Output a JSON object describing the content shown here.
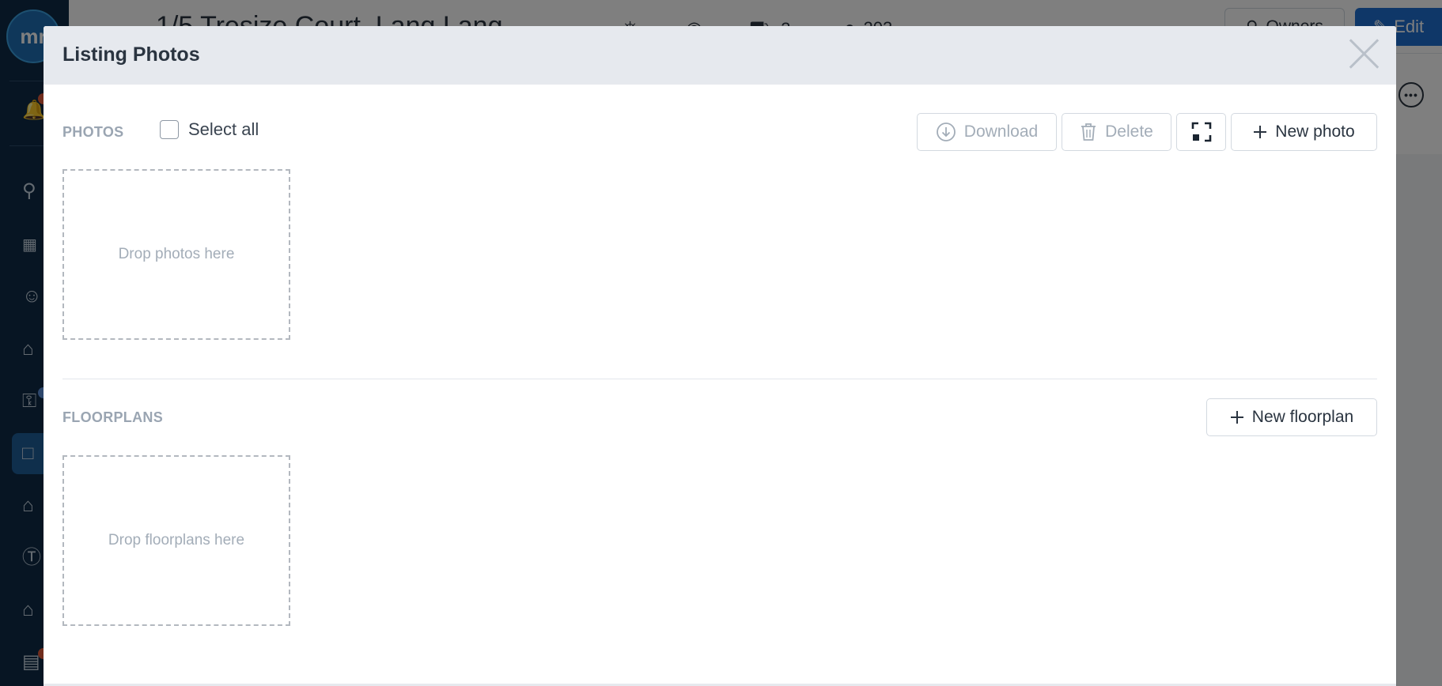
{
  "background": {
    "logo_text": "mr",
    "page_title": "1/5 Tresize Court, Lang Lang",
    "stats": [
      {
        "icon": "car-icon",
        "value": "3"
      },
      {
        "icon": "people-icon",
        "value": "203"
      }
    ],
    "owners_label": "Owners",
    "edit_label": "Edit",
    "sidebar_icons": [
      "bell-icon",
      "search-icon",
      "dashboard-icon",
      "person-icon",
      "home-icon",
      "key-icon",
      "listing-icon",
      "property-icon",
      "dollar-icon",
      "house-settings-icon",
      "document-icon"
    ]
  },
  "modal": {
    "title": "Listing Photos",
    "photos": {
      "section_label": "PHOTOS",
      "select_all_label": "Select all",
      "download_label": "Download",
      "delete_label": "Delete",
      "new_photo_label": "New photo",
      "dropzone_text": "Drop photos here"
    },
    "floorplans": {
      "section_label": "FLOORPLANS",
      "new_floorplan_label": "New floorplan",
      "dropzone_text": "Drop floorplans here"
    }
  },
  "colors": {
    "accent": "#1f6fd0",
    "sidebar": "#0f2b47",
    "header": "#e6e9ee",
    "muted_text": "#9aa5b2"
  }
}
